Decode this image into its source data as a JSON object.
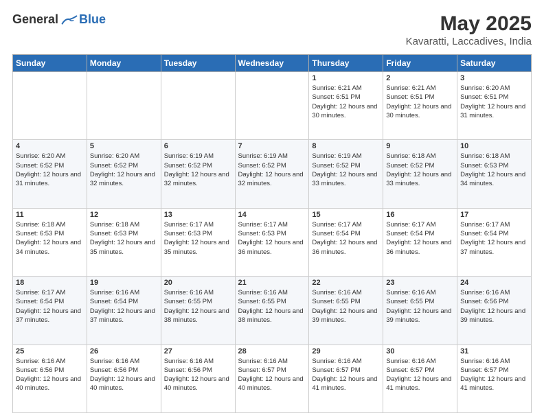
{
  "header": {
    "logo_general": "General",
    "logo_blue": "Blue",
    "title": "May 2025",
    "subtitle": "Kavaratti, Laccadives, India"
  },
  "weekdays": [
    "Sunday",
    "Monday",
    "Tuesday",
    "Wednesday",
    "Thursday",
    "Friday",
    "Saturday"
  ],
  "weeks": [
    [
      {
        "day": "",
        "info": ""
      },
      {
        "day": "",
        "info": ""
      },
      {
        "day": "",
        "info": ""
      },
      {
        "day": "",
        "info": ""
      },
      {
        "day": "1",
        "info": "Sunrise: 6:21 AM\nSunset: 6:51 PM\nDaylight: 12 hours and 30 minutes."
      },
      {
        "day": "2",
        "info": "Sunrise: 6:21 AM\nSunset: 6:51 PM\nDaylight: 12 hours and 30 minutes."
      },
      {
        "day": "3",
        "info": "Sunrise: 6:20 AM\nSunset: 6:51 PM\nDaylight: 12 hours and 31 minutes."
      }
    ],
    [
      {
        "day": "4",
        "info": "Sunrise: 6:20 AM\nSunset: 6:52 PM\nDaylight: 12 hours and 31 minutes."
      },
      {
        "day": "5",
        "info": "Sunrise: 6:20 AM\nSunset: 6:52 PM\nDaylight: 12 hours and 32 minutes."
      },
      {
        "day": "6",
        "info": "Sunrise: 6:19 AM\nSunset: 6:52 PM\nDaylight: 12 hours and 32 minutes."
      },
      {
        "day": "7",
        "info": "Sunrise: 6:19 AM\nSunset: 6:52 PM\nDaylight: 12 hours and 32 minutes."
      },
      {
        "day": "8",
        "info": "Sunrise: 6:19 AM\nSunset: 6:52 PM\nDaylight: 12 hours and 33 minutes."
      },
      {
        "day": "9",
        "info": "Sunrise: 6:18 AM\nSunset: 6:52 PM\nDaylight: 12 hours and 33 minutes."
      },
      {
        "day": "10",
        "info": "Sunrise: 6:18 AM\nSunset: 6:53 PM\nDaylight: 12 hours and 34 minutes."
      }
    ],
    [
      {
        "day": "11",
        "info": "Sunrise: 6:18 AM\nSunset: 6:53 PM\nDaylight: 12 hours and 34 minutes."
      },
      {
        "day": "12",
        "info": "Sunrise: 6:18 AM\nSunset: 6:53 PM\nDaylight: 12 hours and 35 minutes."
      },
      {
        "day": "13",
        "info": "Sunrise: 6:17 AM\nSunset: 6:53 PM\nDaylight: 12 hours and 35 minutes."
      },
      {
        "day": "14",
        "info": "Sunrise: 6:17 AM\nSunset: 6:53 PM\nDaylight: 12 hours and 36 minutes."
      },
      {
        "day": "15",
        "info": "Sunrise: 6:17 AM\nSunset: 6:54 PM\nDaylight: 12 hours and 36 minutes."
      },
      {
        "day": "16",
        "info": "Sunrise: 6:17 AM\nSunset: 6:54 PM\nDaylight: 12 hours and 36 minutes."
      },
      {
        "day": "17",
        "info": "Sunrise: 6:17 AM\nSunset: 6:54 PM\nDaylight: 12 hours and 37 minutes."
      }
    ],
    [
      {
        "day": "18",
        "info": "Sunrise: 6:17 AM\nSunset: 6:54 PM\nDaylight: 12 hours and 37 minutes."
      },
      {
        "day": "19",
        "info": "Sunrise: 6:16 AM\nSunset: 6:54 PM\nDaylight: 12 hours and 37 minutes."
      },
      {
        "day": "20",
        "info": "Sunrise: 6:16 AM\nSunset: 6:55 PM\nDaylight: 12 hours and 38 minutes."
      },
      {
        "day": "21",
        "info": "Sunrise: 6:16 AM\nSunset: 6:55 PM\nDaylight: 12 hours and 38 minutes."
      },
      {
        "day": "22",
        "info": "Sunrise: 6:16 AM\nSunset: 6:55 PM\nDaylight: 12 hours and 39 minutes."
      },
      {
        "day": "23",
        "info": "Sunrise: 6:16 AM\nSunset: 6:55 PM\nDaylight: 12 hours and 39 minutes."
      },
      {
        "day": "24",
        "info": "Sunrise: 6:16 AM\nSunset: 6:56 PM\nDaylight: 12 hours and 39 minutes."
      }
    ],
    [
      {
        "day": "25",
        "info": "Sunrise: 6:16 AM\nSunset: 6:56 PM\nDaylight: 12 hours and 40 minutes."
      },
      {
        "day": "26",
        "info": "Sunrise: 6:16 AM\nSunset: 6:56 PM\nDaylight: 12 hours and 40 minutes."
      },
      {
        "day": "27",
        "info": "Sunrise: 6:16 AM\nSunset: 6:56 PM\nDaylight: 12 hours and 40 minutes."
      },
      {
        "day": "28",
        "info": "Sunrise: 6:16 AM\nSunset: 6:57 PM\nDaylight: 12 hours and 40 minutes."
      },
      {
        "day": "29",
        "info": "Sunrise: 6:16 AM\nSunset: 6:57 PM\nDaylight: 12 hours and 41 minutes."
      },
      {
        "day": "30",
        "info": "Sunrise: 6:16 AM\nSunset: 6:57 PM\nDaylight: 12 hours and 41 minutes."
      },
      {
        "day": "31",
        "info": "Sunrise: 6:16 AM\nSunset: 6:57 PM\nDaylight: 12 hours and 41 minutes."
      }
    ]
  ]
}
